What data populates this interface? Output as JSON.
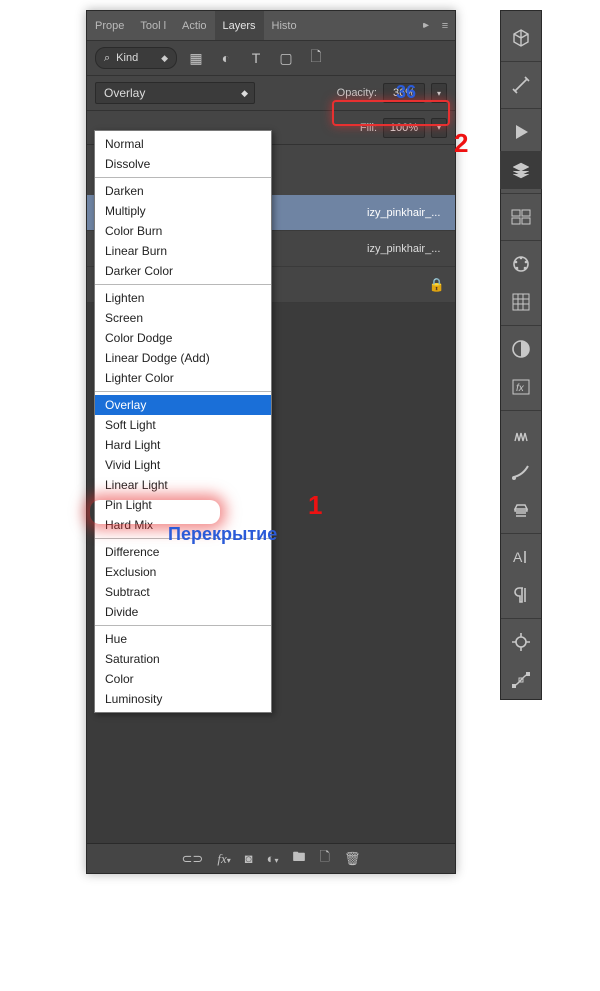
{
  "tabs": {
    "t0": "Prope",
    "t1": "Tool l",
    "t2": "Actio",
    "t3": "Layers",
    "t4": "Histo"
  },
  "filter": {
    "kind": "Kind"
  },
  "mode": {
    "current": "Overlay",
    "opacity_label": "Opacity:",
    "opacity_value": "36%",
    "fill_label": "Fill:",
    "fill_value": "100%"
  },
  "layers": {
    "l0": "izy_pinkhair_...",
    "l1": "izy_pinkhair_..."
  },
  "blend_modes": {
    "g0": {
      "i0": "Normal",
      "i1": "Dissolve"
    },
    "g1": {
      "i0": "Darken",
      "i1": "Multiply",
      "i2": "Color Burn",
      "i3": "Linear Burn",
      "i4": "Darker Color"
    },
    "g2": {
      "i0": "Lighten",
      "i1": "Screen",
      "i2": "Color Dodge",
      "i3": "Linear Dodge (Add)",
      "i4": "Lighter Color"
    },
    "g3": {
      "i0": "Overlay",
      "i1": "Soft Light",
      "i2": "Hard Light",
      "i3": "Vivid Light",
      "i4": "Linear Light",
      "i5": "Pin Light",
      "i6": "Hard Mix"
    },
    "g4": {
      "i0": "Difference",
      "i1": "Exclusion",
      "i2": "Subtract",
      "i3": "Divide"
    },
    "g5": {
      "i0": "Hue",
      "i1": "Saturation",
      "i2": "Color",
      "i3": "Luminosity"
    }
  },
  "annotations": {
    "n1": "1",
    "n2": "2",
    "n36": "36",
    "overlay_ru": "Перекрытие"
  },
  "glyphs": {
    "play": "▶",
    "diamond": "◆",
    "tri_down": "▾",
    "tri_up": "▴",
    "more": "▸▸",
    "menu": "≡"
  }
}
